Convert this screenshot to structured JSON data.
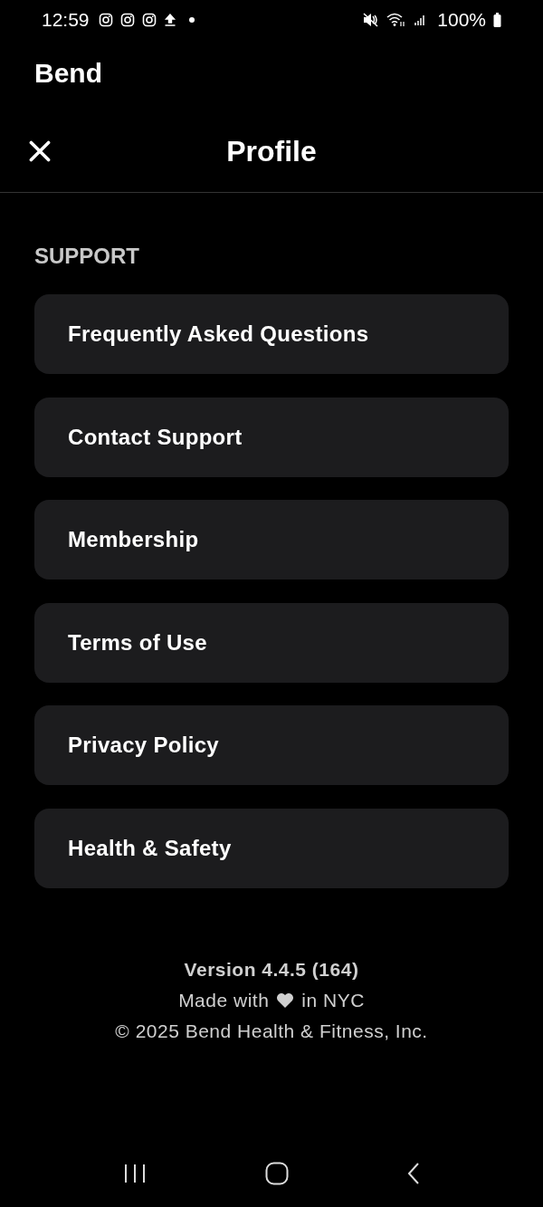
{
  "status_bar": {
    "time": "12:59",
    "battery": "100%"
  },
  "app_name": "Bend",
  "header": {
    "title": "Profile"
  },
  "section": {
    "title": "SUPPORT",
    "items": [
      {
        "label": "Frequently Asked Questions"
      },
      {
        "label": "Contact Support"
      },
      {
        "label": "Membership"
      },
      {
        "label": "Terms of Use"
      },
      {
        "label": "Privacy Policy"
      },
      {
        "label": "Health & Safety"
      }
    ]
  },
  "footer": {
    "version": "Version 4.4.5 (164)",
    "made_before": "Made with",
    "made_after": "in NYC",
    "copyright": "© 2025 Bend Health & Fitness, Inc."
  }
}
